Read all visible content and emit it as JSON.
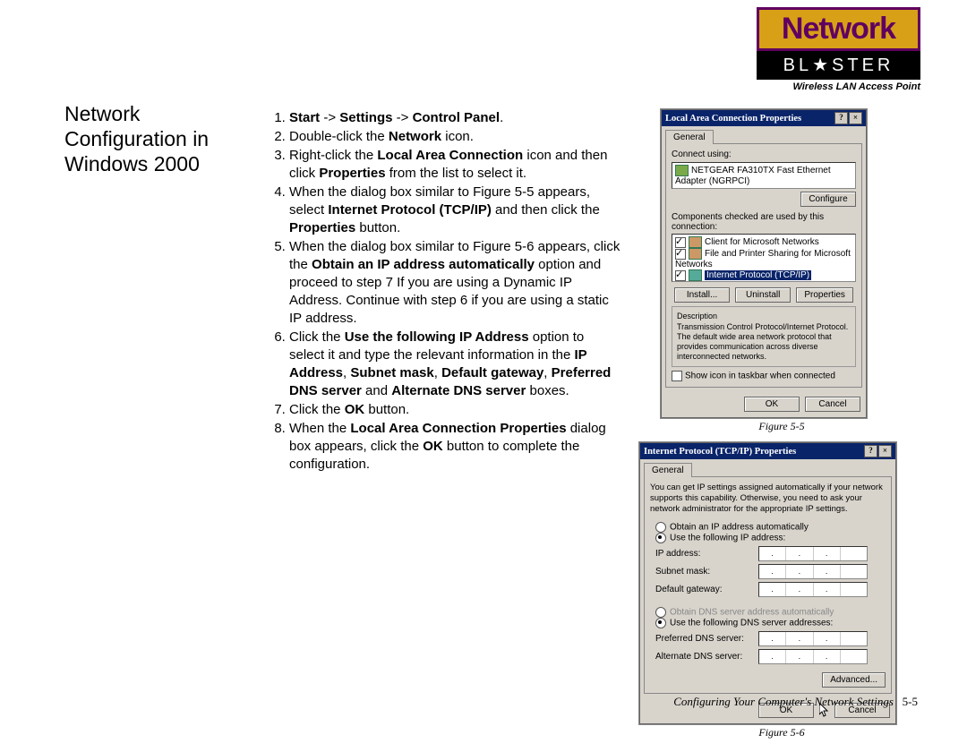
{
  "logo": {
    "top": "Network",
    "bottom": "BL★STER",
    "sub": "Wireless LAN Access Point"
  },
  "section_title": "Network Configuration in Windows 2000",
  "steps_a": [
    {
      "html": "<b>Start</b> -> <b>Settings</b> -> <b>Control Panel</b>."
    },
    {
      "html": "Double-click the <b>Network</b> icon."
    },
    {
      "html": "Right-click the <b>Local Area Connection</b> icon and then click <b>Properties</b> from the list to select it."
    },
    {
      "html": "When the dialog box similar to Figure 5-5 appears, select <b>Internet Protocol (TCP/IP)</b> and then click the <b>Properties</b> button."
    }
  ],
  "steps_b": [
    {
      "html": "When the dialog box similar to Figure 5-6 appears, click the <b>Obtain an IP address automatically</b> option and proceed to step 7 If you are using a Dynamic IP Address. Continue with step 6 if you are using a static IP address."
    },
    {
      "html": "Click the <b>Use the following IP Address</b> option to select it and type the relevant information in the <b>IP Address</b>, <b>Subnet mask</b>, <b>Default gateway</b>, <b>Preferred DNS server</b> and <b>Alternate DNS server</b> boxes."
    },
    {
      "html": "Click the <b>OK</b> button."
    },
    {
      "html": "When the <b>Local Area Connection Properties</b> dialog box appears, click the <b>OK</b> button to complete the configuration."
    }
  ],
  "fig55": {
    "caption": "Figure 5-5",
    "title": "Local Area Connection Properties",
    "tab": "General",
    "connect_using": "Connect using:",
    "adapter": "NETGEAR FA310TX Fast Ethernet Adapter (NGRPCI)",
    "configure": "Configure",
    "components_label": "Components checked are used by this connection:",
    "comp1": "Client for Microsoft Networks",
    "comp2": "File and Printer Sharing for Microsoft Networks",
    "comp3": "Internet Protocol (TCP/IP)",
    "install": "Install...",
    "uninstall": "Uninstall",
    "properties": "Properties",
    "desc_label": "Description",
    "desc": "Transmission Control Protocol/Internet Protocol. The default wide area network protocol that provides communication across diverse interconnected networks.",
    "showicon": "Show icon in taskbar when connected",
    "ok": "OK",
    "cancel": "Cancel"
  },
  "fig56": {
    "caption": "Figure 5-6",
    "title": "Internet Protocol (TCP/IP) Properties",
    "tab": "General",
    "intro": "You can get IP settings assigned automatically if your network supports this capability. Otherwise, you need to ask your network administrator for the appropriate IP settings.",
    "r1": "Obtain an IP address automatically",
    "r2": "Use the following IP address:",
    "ip": "IP address:",
    "subnet": "Subnet mask:",
    "gateway": "Default gateway:",
    "r3": "Obtain DNS server address automatically",
    "r4": "Use the following DNS server addresses:",
    "pref": "Preferred DNS server:",
    "alt": "Alternate DNS server:",
    "advanced": "Advanced...",
    "ok": "OK",
    "cancel": "Cancel"
  },
  "footer": {
    "text": "Configuring Your Computer's Network Settings",
    "page": "5-5"
  }
}
